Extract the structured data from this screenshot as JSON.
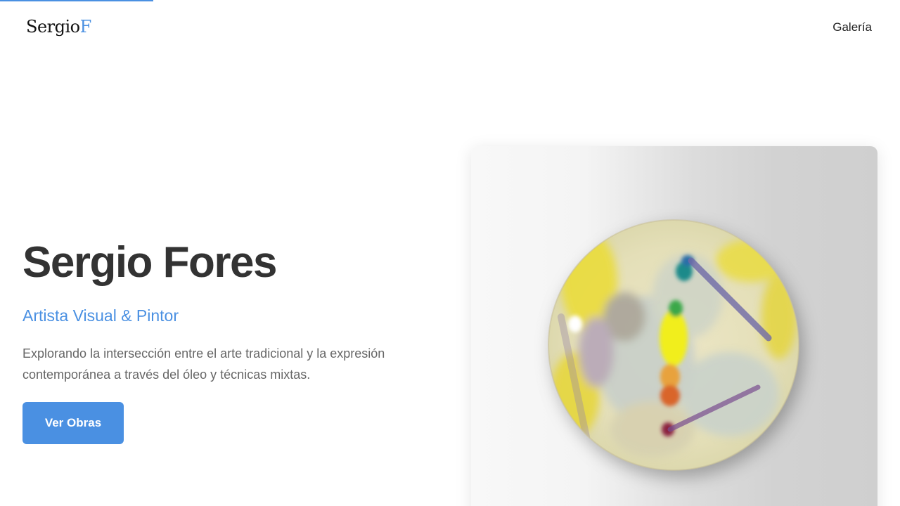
{
  "header": {
    "logo_main": "Sergio",
    "logo_accent": "F",
    "nav_gallery": "Galería"
  },
  "hero": {
    "title": "Sergio Fores",
    "subtitle": "Artista Visual & Pintor",
    "description": "Explorando la intersección entre el arte tradicional y la expresión contemporánea a través del óleo y técnicas mixtas.",
    "cta_label": "Ver Obras"
  },
  "progress": 0.17,
  "colors": {
    "accent": "#4a90e2",
    "title": "#333333",
    "body_text": "#666666"
  },
  "artwork": {
    "shape": "round painted canvas (palette-like abstract)"
  }
}
